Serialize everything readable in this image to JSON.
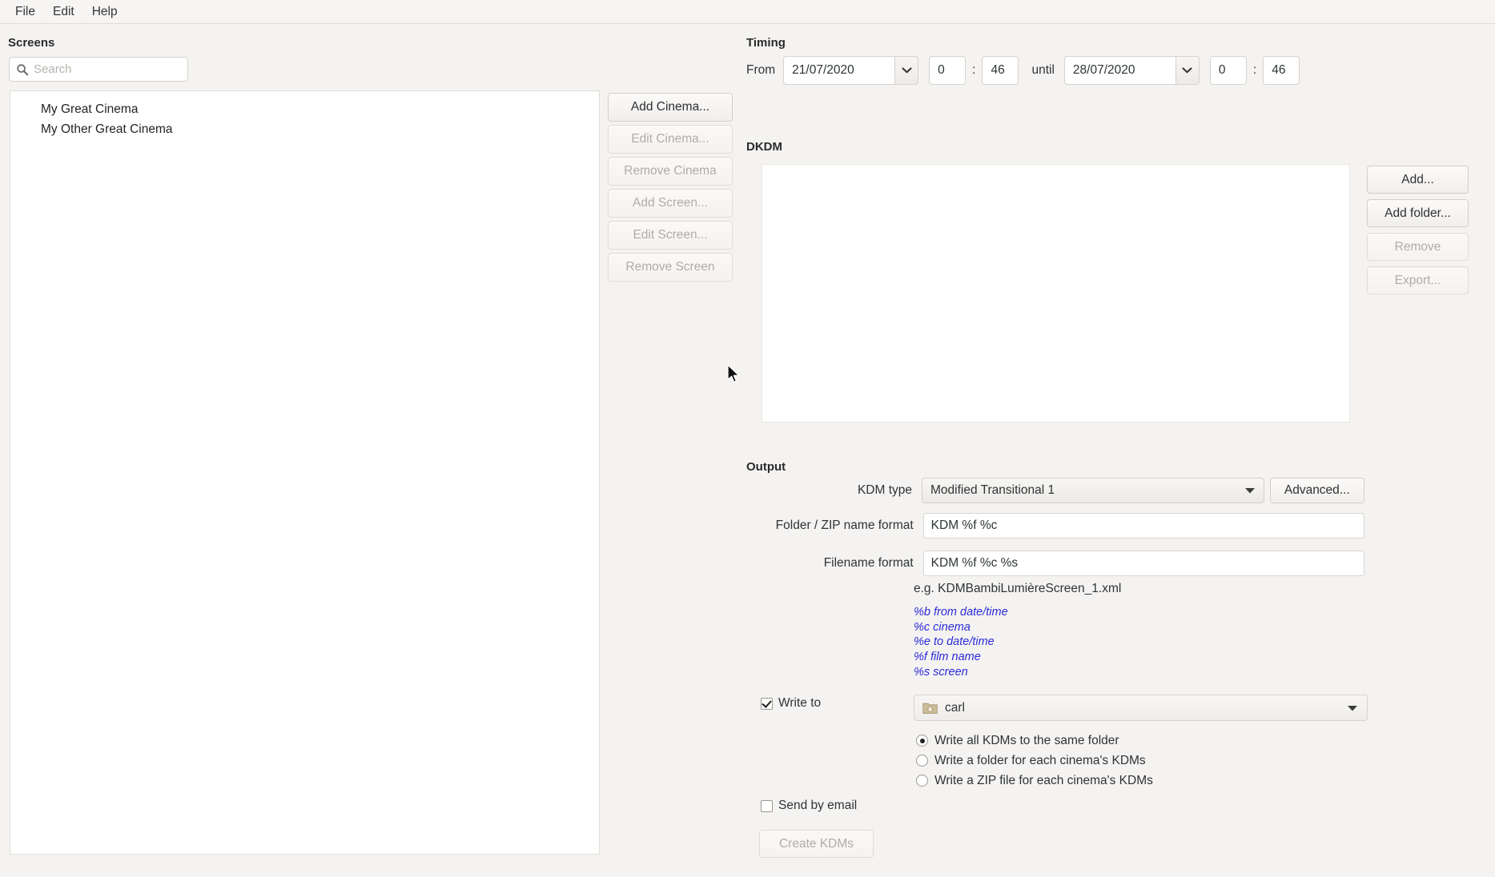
{
  "menubar": {
    "items": [
      {
        "label": "File"
      },
      {
        "label": "Edit"
      },
      {
        "label": "Help"
      }
    ]
  },
  "screens": {
    "title": "Screens",
    "search": {
      "value": "",
      "placeholder": "Search",
      "icon": "search-icon"
    },
    "tree": [
      {
        "label": "My Great Cinema"
      },
      {
        "label": "My Other Great Cinema"
      }
    ],
    "buttons": [
      {
        "label": "Add Cinema...",
        "enabled": true
      },
      {
        "label": "Edit Cinema...",
        "enabled": false
      },
      {
        "label": "Remove Cinema",
        "enabled": false
      },
      {
        "label": "Add Screen...",
        "enabled": false
      },
      {
        "label": "Edit Screen...",
        "enabled": false
      },
      {
        "label": "Remove Screen",
        "enabled": false
      }
    ]
  },
  "timing": {
    "title": "Timing",
    "from_label": "From",
    "from_date": "21/07/2020",
    "from_hour": "0",
    "from_separator": ":",
    "from_minute": "46",
    "until_label": "until",
    "until_date": "28/07/2020",
    "until_hour": "0",
    "until_separator": ":",
    "until_minute": "46"
  },
  "dkdm": {
    "title": "DKDM",
    "items": [],
    "buttons": [
      {
        "label": "Add...",
        "enabled": true
      },
      {
        "label": "Add folder...",
        "enabled": true
      },
      {
        "label": "Remove",
        "enabled": false
      },
      {
        "label": "Export...",
        "enabled": false
      }
    ]
  },
  "output": {
    "title": "Output",
    "kdm_type_label": "KDM type",
    "kdm_type_value": "Modified Transitional 1",
    "advanced_label": "Advanced...",
    "folder_format_label": "Folder / ZIP name format",
    "folder_format_value": "KDM %f %c",
    "filename_format_label": "Filename format",
    "filename_format_value": "KDM %f %c %s",
    "example": "e.g. KDMBambiLumièreScreen_1.xml",
    "variables": [
      "%b from date/time",
      "%c cinema",
      "%e to date/time",
      "%f film name",
      "%s screen"
    ],
    "variables_color": "#2a2ad8",
    "write_to_label": "Write to",
    "write_to_checked": true,
    "folder_value": "carl",
    "folder_icon": "home-folder-icon",
    "radio_options": [
      {
        "label": "Write all KDMs to the same folder",
        "selected": true
      },
      {
        "label": "Write a folder for each cinema's KDMs",
        "selected": false
      },
      {
        "label": "Write a ZIP file for each cinema's KDMs",
        "selected": false
      }
    ],
    "send_by_email_label": "Send by email",
    "send_by_email_checked": false,
    "create_kdms_label": "Create KDMs",
    "create_kdms_enabled": false
  }
}
